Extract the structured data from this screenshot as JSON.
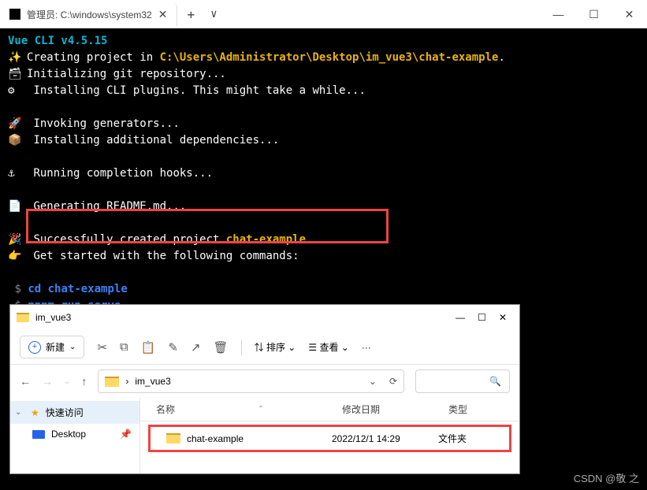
{
  "titlebar": {
    "tab_title": "管理员: C:\\windows\\system32",
    "new_tab": "+",
    "dropdown": "∨",
    "min": "—",
    "max": "☐",
    "close": "✕"
  },
  "terminal": {
    "vue_cli": "Vue CLI v4.5.15",
    "creating_prefix": "Creating project in ",
    "creating_path": "C:\\Users\\Administrator\\Desktop\\im_vue3\\chat-example",
    "creating_suffix": ".",
    "init_git": "Initializing git repository...",
    "install_cli": "Installing CLI plugins. This might take a while...",
    "invoking": "Invoking generators...",
    "install_add": "Installing additional dependencies...",
    "hooks": "Running completion hooks...",
    "readme": "Generating README.md...",
    "success_prefix": "Successfully created project ",
    "success_name": "chat-example",
    "success_suffix": ".",
    "get_started": "Get started with the following commands:",
    "prompt": "$",
    "cmd1": "cd chat-example",
    "cmd2": "pnpm run serve"
  },
  "explorer": {
    "title": "im_vue3",
    "min": "—",
    "max": "☐",
    "close": "✕",
    "new_btn": "新建",
    "sort": "排序",
    "view": "查看",
    "more": "···",
    "path_sep": "›",
    "path_segment": "im_vue3",
    "refresh": "⟳",
    "sidebar": {
      "quick_access": "快速访问",
      "desktop": "Desktop"
    },
    "columns": {
      "name": "名称",
      "date": "修改日期",
      "type": "类型",
      "sort_indicator": "ˆ"
    },
    "row": {
      "name": "chat-example",
      "date": "2022/12/1 14:29",
      "type": "文件夹"
    }
  },
  "watermark": "CSDN @敬 之"
}
